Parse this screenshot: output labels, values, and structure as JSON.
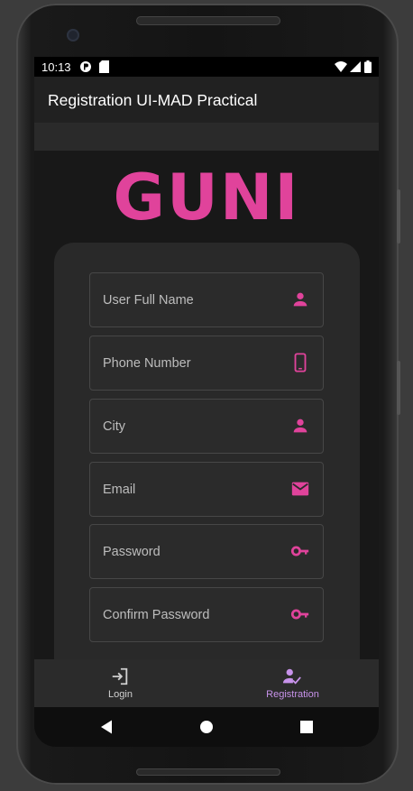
{
  "status_bar": {
    "time": "10:13"
  },
  "app_bar": {
    "title": "Registration UI-MAD Practical"
  },
  "logo": {
    "text": "GUNI"
  },
  "form": {
    "fields": [
      {
        "placeholder": "User Full Name",
        "icon": "person-icon"
      },
      {
        "placeholder": "Phone Number",
        "icon": "phone-icon"
      },
      {
        "placeholder": "City",
        "icon": "person-icon"
      },
      {
        "placeholder": "Email",
        "icon": "email-icon"
      },
      {
        "placeholder": "Password",
        "icon": "key-icon"
      },
      {
        "placeholder": "Confirm Password",
        "icon": "key-icon"
      }
    ]
  },
  "bottom_nav": {
    "items": [
      {
        "label": "Login",
        "icon": "login-icon",
        "active": false
      },
      {
        "label": "Registration",
        "icon": "person-check-icon",
        "active": true
      }
    ]
  },
  "colors": {
    "accent": "#e0439b",
    "active_nav": "#c792ea",
    "inactive_nav": "#d0d0d0",
    "background": "#181818",
    "card": "#292929"
  }
}
